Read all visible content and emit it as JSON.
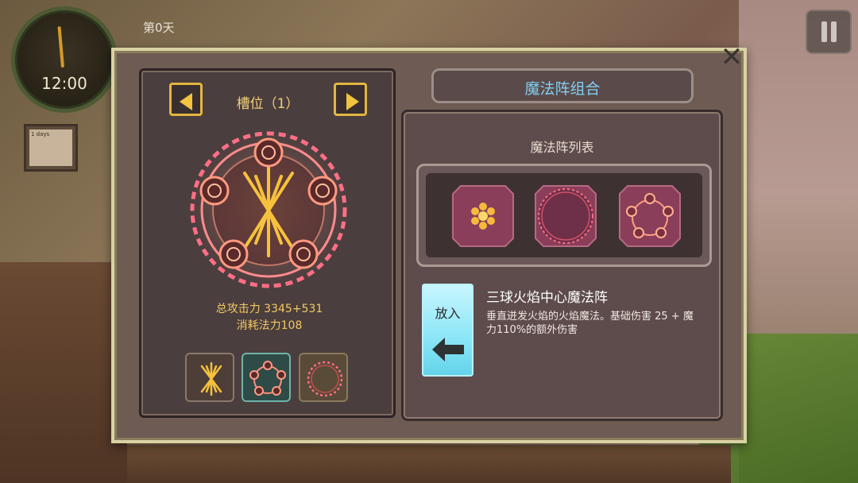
{
  "hud": {
    "clock_time": "12:00",
    "day_label": "第0天",
    "note_text": "1 days",
    "pause_icon": "pause-icon"
  },
  "dialog": {
    "close_icon": "close-icon",
    "slot_label": "槽位（1）",
    "total_attack": "总攻击力 3345+531",
    "mana_cost": "消耗法力108",
    "slots": [
      {
        "icon": "rune-lines-icon"
      },
      {
        "icon": "pentagon-circle-icon"
      },
      {
        "icon": "dotted-circle-icon"
      }
    ],
    "title": "魔法阵组合",
    "list_title": "魔法阵列表",
    "list_tiles": [
      {
        "icon": "flower-rune-icon"
      },
      {
        "icon": "dotted-circle-icon"
      },
      {
        "icon": "pentagon-circle-icon"
      }
    ],
    "put_button_label": "放入",
    "selected_spell": {
      "name": "三球火焰中心魔法阵",
      "description": "垂直迸发火焰的火焰魔法。基础伤害 25 + 魔力110%的额外伤害"
    }
  },
  "colors": {
    "accent_gold": "#f1c33e",
    "title_blue": "#7fd0f4",
    "button_cyan": "#8ae6f6",
    "circle_pink": "#ff7f8a"
  }
}
